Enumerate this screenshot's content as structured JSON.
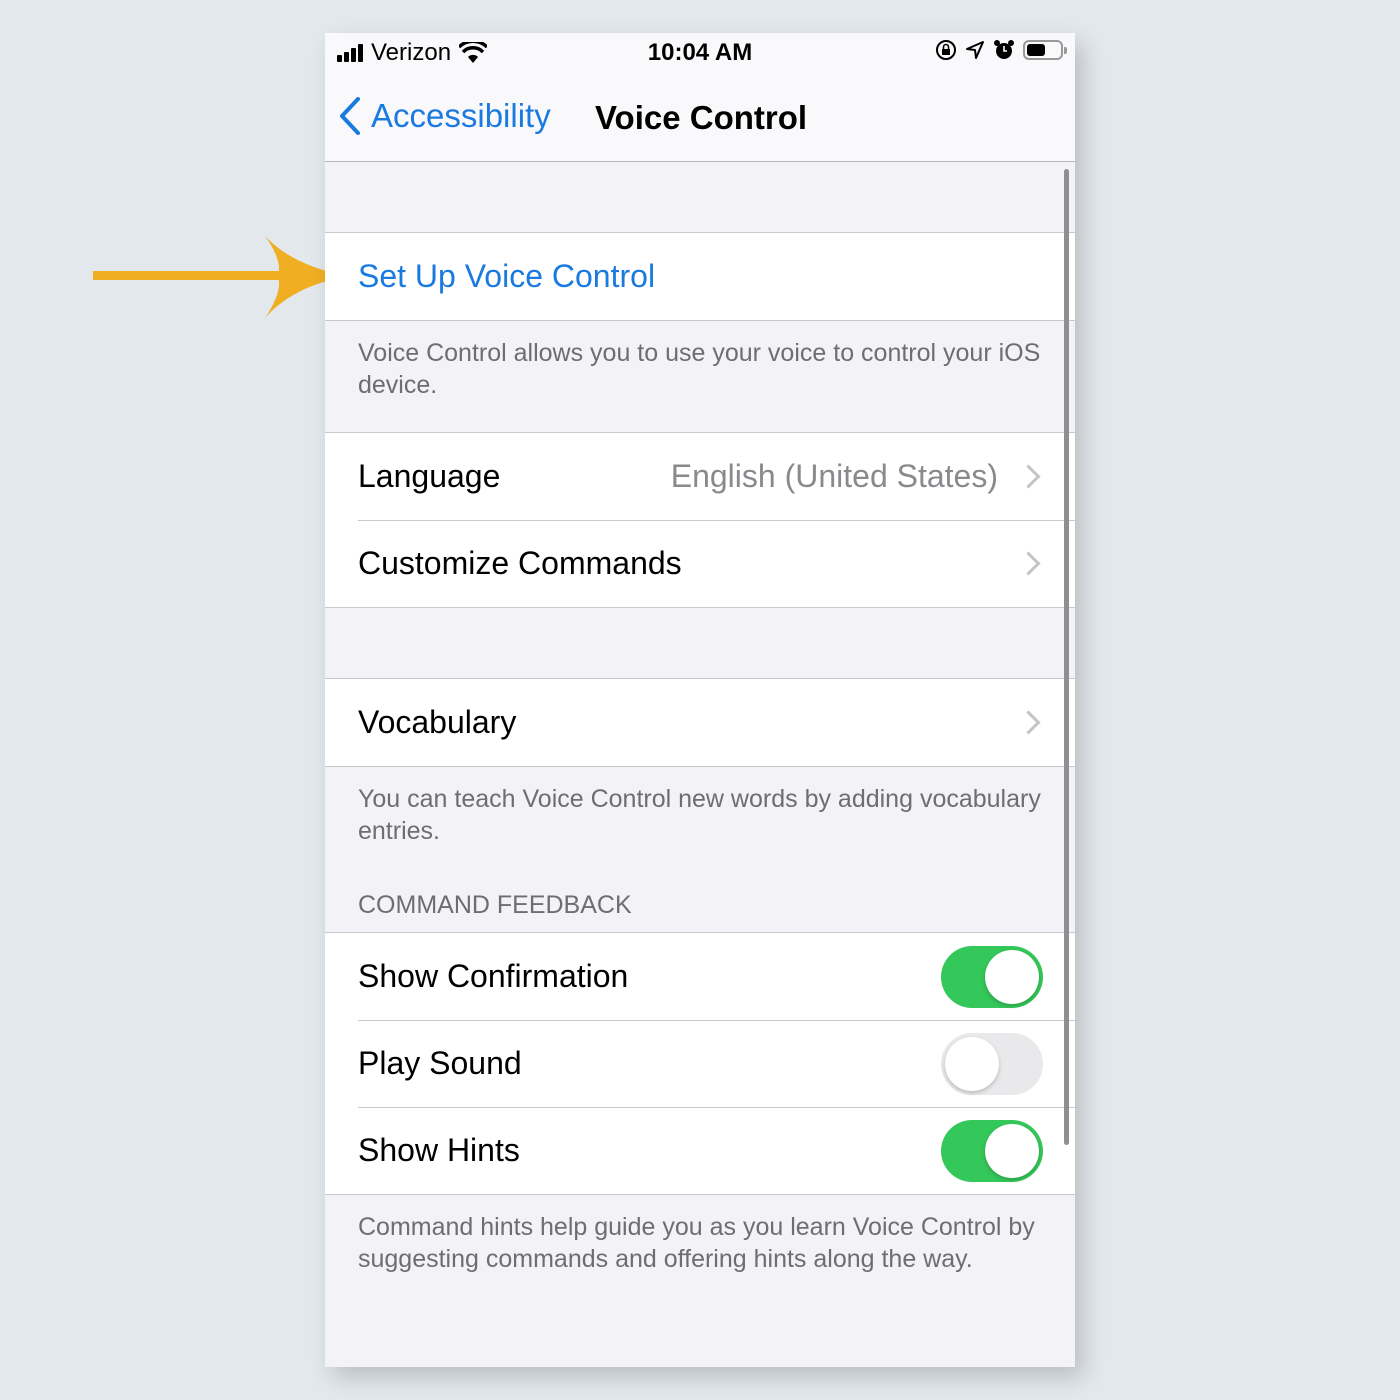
{
  "status_bar": {
    "carrier": "Verizon",
    "time": "10:04 AM",
    "icons": [
      "signal-icon",
      "wifi-icon",
      "orientation-lock-icon",
      "location-icon",
      "alarm-icon",
      "battery-icon"
    ],
    "battery_level": 0.6
  },
  "nav": {
    "back_label": "Accessibility",
    "title": "Voice Control"
  },
  "setup": {
    "label": "Set Up Voice Control",
    "footer": "Voice Control allows you to use your voice to control your iOS device."
  },
  "language_group": {
    "rows": [
      {
        "label": "Language",
        "value": "English (United States)"
      },
      {
        "label": "Customize Commands",
        "value": ""
      }
    ]
  },
  "vocabulary": {
    "label": "Vocabulary",
    "footer": "You can teach Voice Control new words by adding vocabulary entries."
  },
  "command_feedback": {
    "header": "COMMAND FEEDBACK",
    "rows": [
      {
        "label": "Show Confirmation",
        "on": true
      },
      {
        "label": "Play Sound",
        "on": false
      },
      {
        "label": "Show Hints",
        "on": true
      }
    ],
    "footer": "Command hints help guide you as you learn Voice Control by suggesting commands and offering hints along the way."
  },
  "colors": {
    "accent": "#1a7ae0",
    "toggle_on": "#34c759",
    "arrow": "#f0ae22"
  }
}
